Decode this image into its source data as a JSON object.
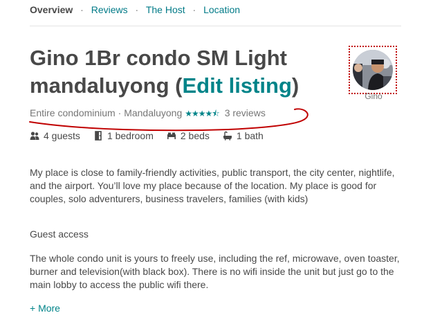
{
  "nav": {
    "overview": "Overview",
    "reviews": "Reviews",
    "host": "The Host",
    "location": "Location",
    "separator": "·"
  },
  "listing": {
    "title_line1": "Gino 1Br condo SM Light",
    "title_line2_start": "mandaluyong (",
    "edit_link": "Edit listing",
    "title_close": ")",
    "type": "Entire condominium",
    "meta_sep": "·",
    "city": "Mandaluyong",
    "rating_stars": 4.5,
    "reviews": "3 reviews"
  },
  "host": {
    "name": "Gino"
  },
  "amenities": {
    "guests": "4 guests",
    "bedrooms": "1 bedroom",
    "beds": "2 beds",
    "baths": "1 bath"
  },
  "description": "My place is close to family-friendly activities, public transport, the city center, nightlife, and the airport. You’ll love my place because of the location. My place is good for couples, solo adventurers, business travelers, families (with kids)",
  "guest_access": {
    "heading": "Guest access",
    "text": "The whole condo unit is yours to freely use, including the ref, microwave, oven toaster, burner and television(with black box). There is no wifi inside the unit but just go to the main lobby to access the public wifi there."
  },
  "more_link": "+ More",
  "colors": {
    "accent": "#008489",
    "annotation": "#c00000"
  },
  "icons": [
    "guests-icon",
    "bedroom-icon",
    "bed-icon",
    "bath-icon"
  ]
}
